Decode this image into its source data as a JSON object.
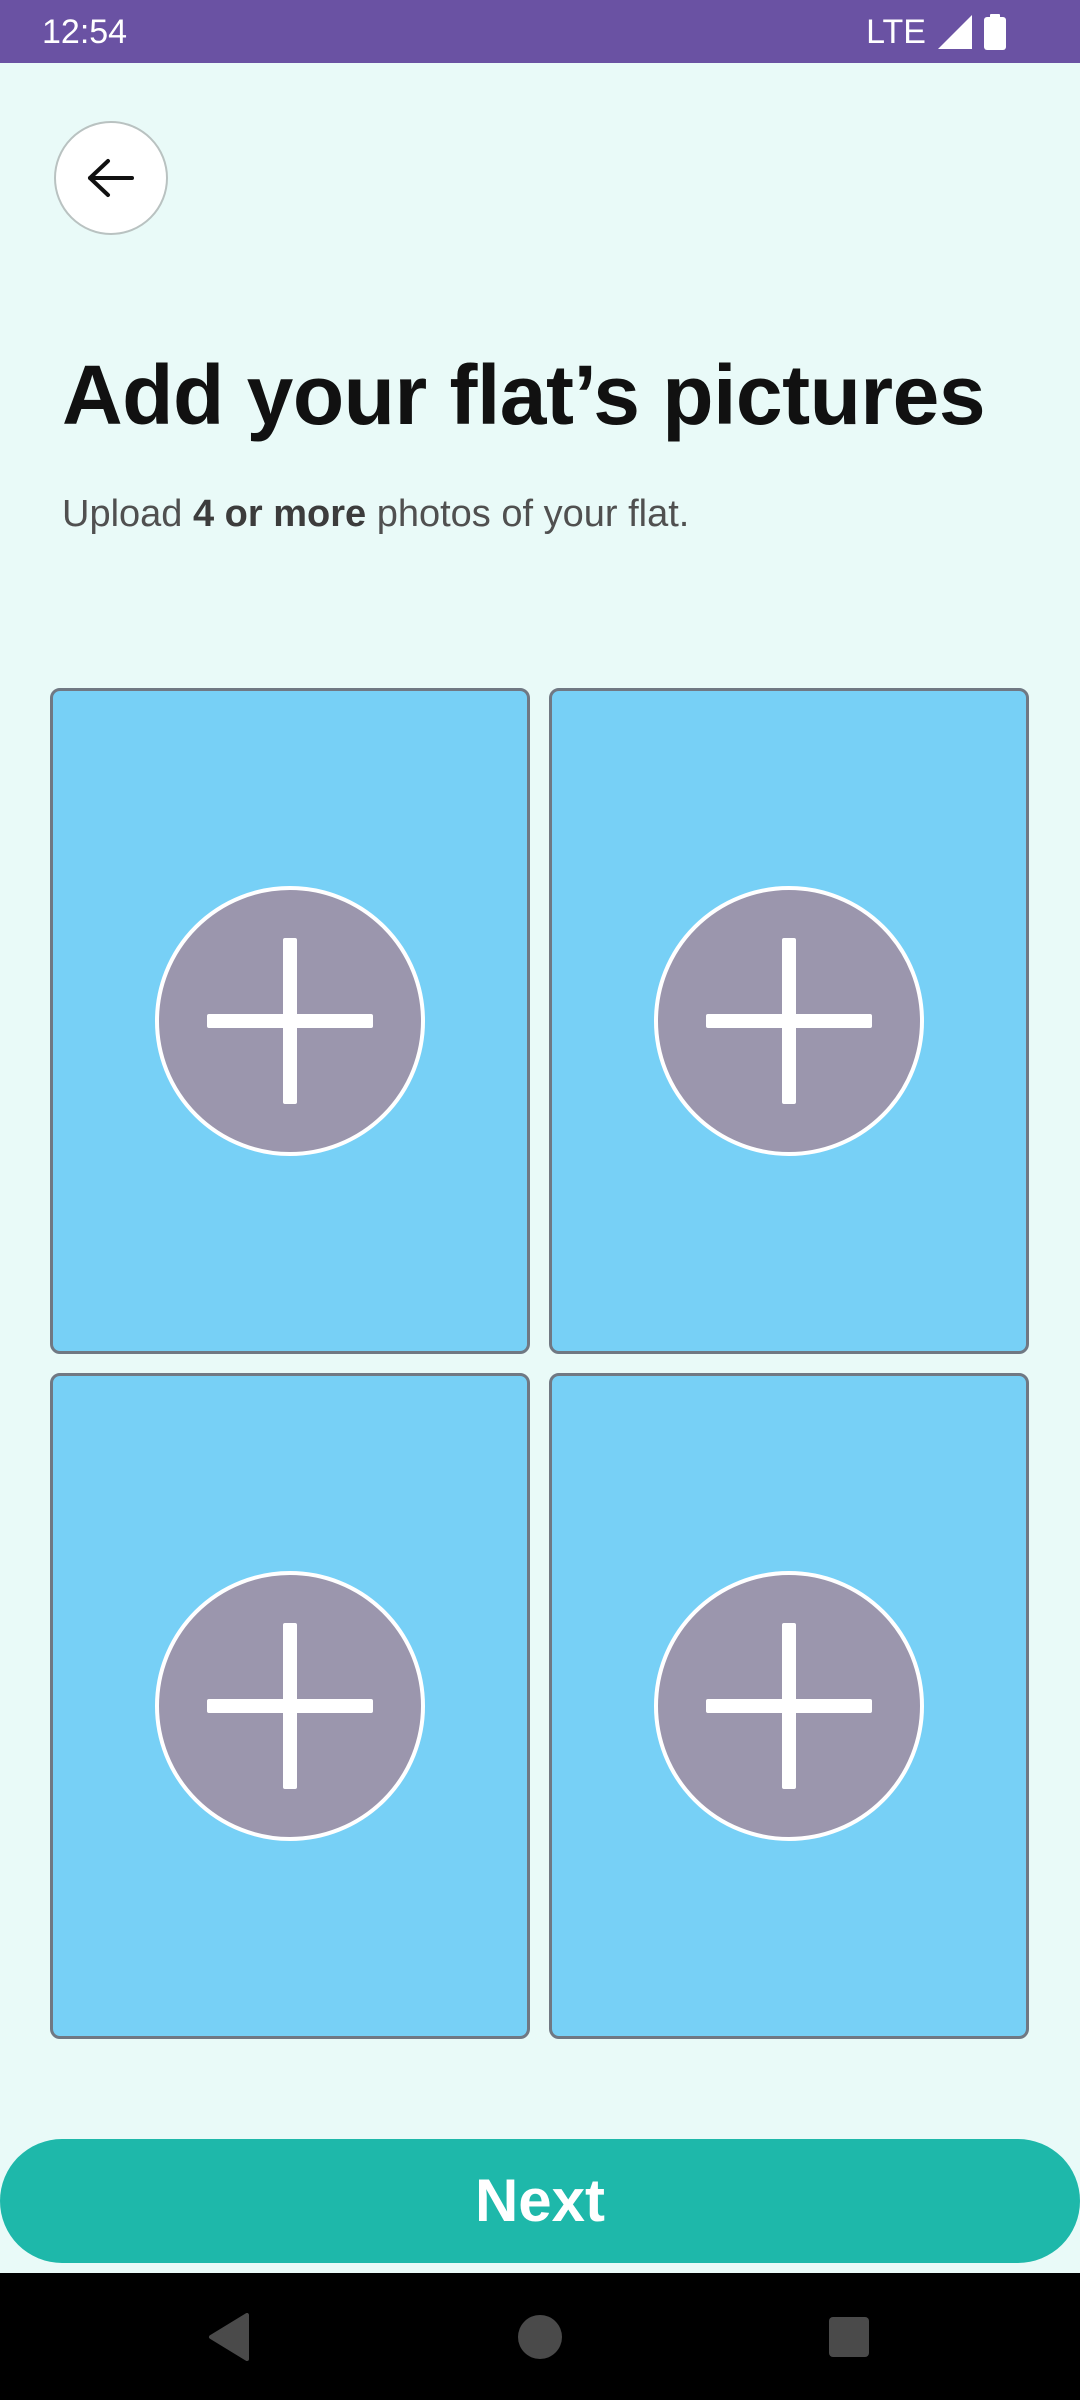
{
  "status_bar": {
    "time": "12:54",
    "network": "LTE",
    "icons": [
      "signal-icon",
      "battery-icon"
    ],
    "background_color": "#6a52a3"
  },
  "header": {
    "back_icon": "arrow-left-icon"
  },
  "page": {
    "title": "Add your flat’s pictures",
    "subtitle_prefix": "Upload ",
    "subtitle_bold": "4 or more",
    "subtitle_suffix": " photos of your flat."
  },
  "photo_slots": [
    {
      "icon": "plus-icon"
    },
    {
      "icon": "plus-icon"
    },
    {
      "icon": "plus-icon"
    },
    {
      "icon": "plus-icon"
    }
  ],
  "next_button": {
    "label": "Next",
    "color": "#1eb8aa"
  },
  "colors": {
    "background": "#e9faf8",
    "slot_fill": "#77d0f6",
    "add_circle": "#9b96ad"
  },
  "nav_bar": {
    "icons": [
      "nav-back-icon",
      "nav-home-icon",
      "nav-recents-icon"
    ]
  }
}
